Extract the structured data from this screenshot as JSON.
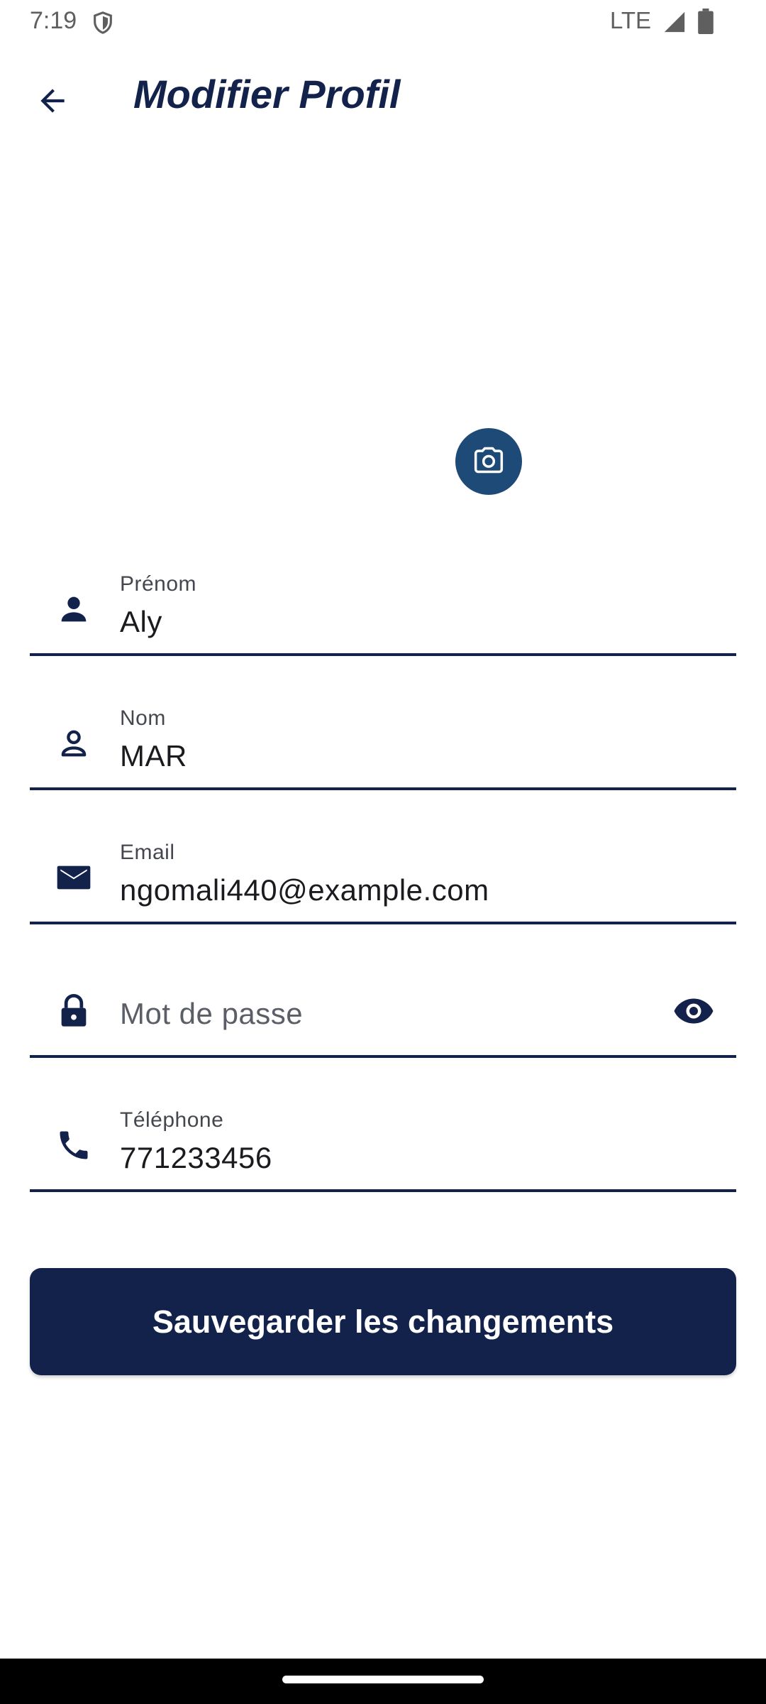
{
  "status_bar": {
    "time": "7:19",
    "network": "LTE",
    "icons": [
      "shield-icon",
      "signal-icon",
      "battery-icon"
    ]
  },
  "app_bar": {
    "title": "Modifier Profil",
    "back_icon": "arrow-back-icon"
  },
  "avatar": {
    "camera_icon": "camera-icon"
  },
  "form": {
    "first_name": {
      "label": "Prénom",
      "value": "Aly",
      "icon": "person-filled-icon"
    },
    "last_name": {
      "label": "Nom",
      "value": "MAR",
      "icon": "person-outline-icon"
    },
    "email": {
      "label": "Email",
      "value": "ngomali440@example.com",
      "icon": "mail-icon"
    },
    "password": {
      "placeholder": "Mot de passe",
      "value": "",
      "icon": "lock-icon",
      "toggle_icon": "eye-icon"
    },
    "phone": {
      "label": "Téléphone",
      "value": "771233456",
      "icon": "phone-icon"
    }
  },
  "actions": {
    "save_label": "Sauvegarder les changements"
  },
  "colors": {
    "primary": "#13224a",
    "camera_button": "#1e4a78",
    "label": "#44474e",
    "text": "#1b1b1f"
  }
}
